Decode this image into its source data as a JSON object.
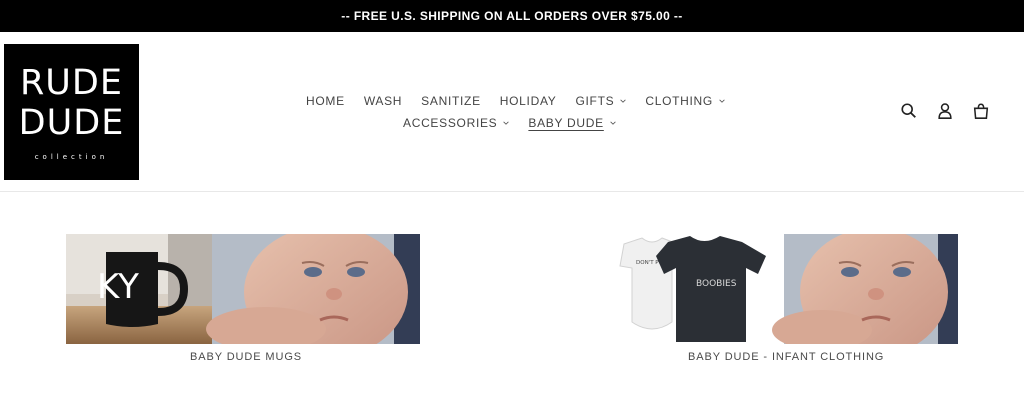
{
  "announcement": "-- FREE U.S. SHIPPING ON ALL ORDERS OVER $75.00 --",
  "logo": {
    "line1": "RUDE",
    "line2": "DUDE",
    "line3": "collection"
  },
  "nav": {
    "row1": [
      {
        "label": "HOME"
      },
      {
        "label": "WASH"
      },
      {
        "label": "SANITIZE"
      },
      {
        "label": "HOLIDAY"
      },
      {
        "label": "GIFTS",
        "dropdown": true
      },
      {
        "label": "CLOTHING",
        "dropdown": true
      }
    ],
    "row2": [
      {
        "label": "ACCESSORIES",
        "dropdown": true
      },
      {
        "label": "BABY DUDE",
        "dropdown": true,
        "active": true
      }
    ]
  },
  "header_icons": [
    "search-icon",
    "account-icon",
    "cart-icon"
  ],
  "collections": [
    {
      "title": "BABY DUDE MUGS",
      "image_text": "KY"
    },
    {
      "title": "BABY DUDE - INFANT CLOTHING",
      "image_text": [
        "DON'T PUT THOSE AWAY YET",
        "BOOBIES"
      ]
    }
  ],
  "colors": {
    "announcement_bg": "#000000",
    "logo_bg": "#000000",
    "text": "#3d3d3d"
  }
}
